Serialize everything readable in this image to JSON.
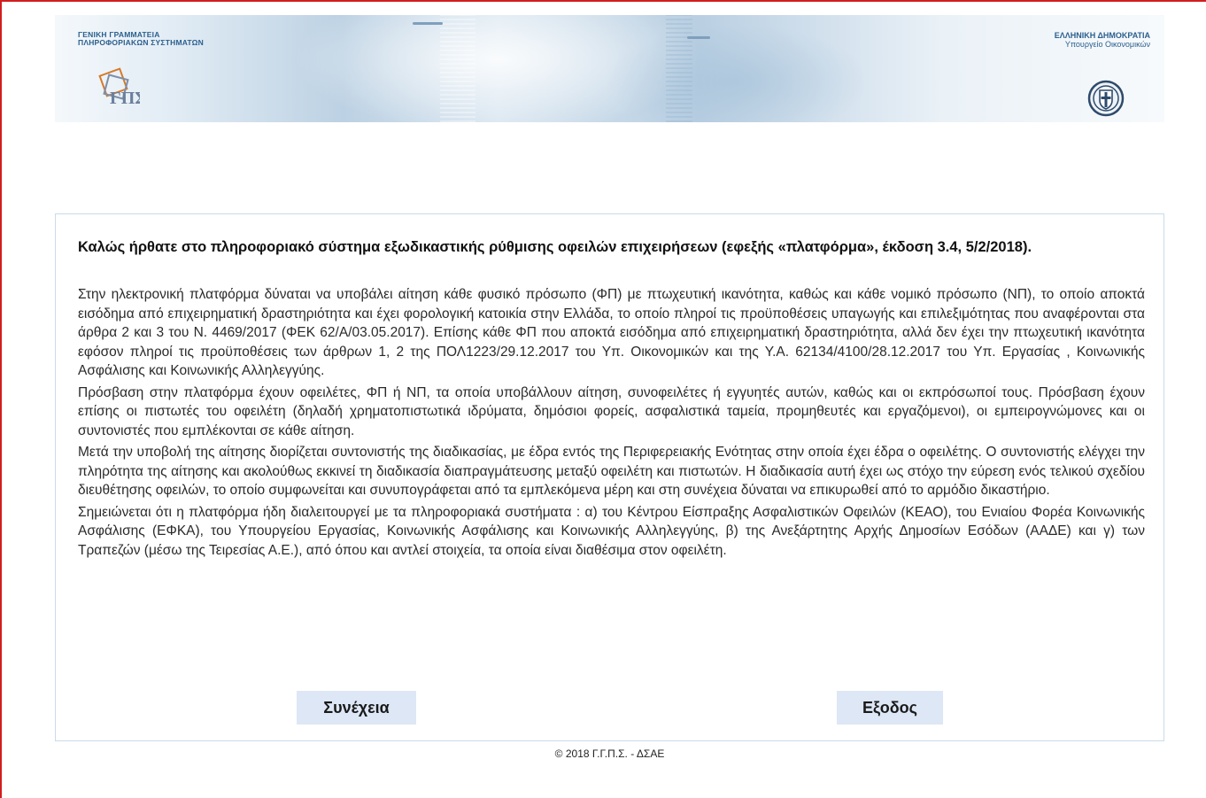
{
  "header": {
    "left_org_line1": "ΓΕΝΙΚΗ ΓΡΑΜΜΑΤΕΙΑ",
    "left_org_line2": "ΠΛΗΡΟΦΟΡΙΑΚΩΝ ΣΥΣΤΗΜΑΤΩΝ",
    "right_org_line1": "ΕΛΛΗΝΙΚΗ ΔΗΜΟΚΡΑΤΙΑ",
    "right_org_line2": "Υπουργείο Οικονομικών",
    "left_logo_icon": "gspis-logo-icon",
    "right_logo_icon": "hellenic-emblem-icon"
  },
  "main": {
    "title": "Καλώς ήρθατε στο πληροφοριακό σύστημα εξωδικαστικής ρύθμισης οφειλών επιχειρήσεων (εφεξής «πλατφόρμα», έκδοση 3.4, 5/2/2018).",
    "paragraphs": [
      "Στην ηλεκτρονική πλατφόρμα δύναται να υποβάλει αίτηση κάθε φυσικό πρόσωπο (ΦΠ) με πτωχευτική ικανότητα, καθώς και κάθε νομικό πρόσωπο (ΝΠ), το οποίο αποκτά εισόδημα από επιχειρηματική δραστηριότητα και έχει φορολογική κατοικία στην Ελλάδα, το οποίο πληροί τις προϋποθέσεις υπαγωγής και επιλεξιμότητας που αναφέρονται στα άρθρα 2 και 3 του Ν. 4469/2017 (ΦΕΚ 62/Α/03.05.2017). Επίσης κάθε ΦΠ που αποκτά εισόδημα από επιχειρηματική δραστηριότητα, αλλά δεν έχει την πτωχευτική ικανότητα εφόσον πληροί τις προϋποθέσεις των άρθρων 1, 2 της ΠΟΛ1223/29.12.2017 του Υπ. Οικονομικών και της Υ.Α. 62134/4100/28.12.2017 του Υπ. Εργασίας , Κοινωνικής Ασφάλισης και Κοινωνικής Αλληλεγγύης.",
      "Πρόσβαση στην πλατφόρμα έχουν οφειλέτες, ΦΠ ή ΝΠ, τα οποία υποβάλλουν αίτηση, συνοφειλέτες ή εγγυητές αυτών, καθώς και οι εκπρόσωποί τους. Πρόσβαση έχουν επίσης οι πιστωτές του οφειλέτη (δηλαδή χρηματοπιστωτικά ιδρύματα, δημόσιοι φορείς, ασφαλιστικά ταμεία, προμηθευτές και εργαζόμενοι), οι εμπειρογνώμονες και οι συντονιστές που εμπλέκονται σε κάθε αίτηση.",
      "Μετά την υποβολή της αίτησης διορίζεται συντονιστής της διαδικασίας, με έδρα εντός της Περιφερειακής Ενότητας στην οποία έχει έδρα ο οφειλέτης. Ο συντονιστής ελέγχει την πληρότητα της αίτησης και ακολούθως εκκινεί τη διαδικασία διαπραγμάτευσης μεταξύ οφειλέτη και πιστωτών. Η διαδικασία αυτή έχει ως στόχο την εύρεση ενός τελικού σχεδίου διευθέτησης οφειλών, το οποίο συμφωνείται και συνυπογράφεται από τα εμπλεκόμενα μέρη και στη συνέχεια δύναται να επικυρωθεί από το αρμόδιο δικαστήριο.",
      "Σημειώνεται ότι η πλατφόρμα ήδη διαλειτουργεί με τα πληροφοριακά συστήματα : α) του Κέντρου Είσπραξης Ασφαλιστικών Οφειλών (ΚΕΑΟ), του Ενιαίου Φορέα Κοινωνικής Ασφάλισης (ΕΦΚΑ), του Υπουργείου Εργασίας, Κοινωνικής Ασφάλισης και Κοινωνικής Αλληλεγγύης, β) της Ανεξάρτητης Αρχής Δημοσίων Εσόδων (ΑΑΔΕ) και γ) των Τραπεζών (μέσω της Τειρεσίας Α.Ε.),  από όπου και αντλεί στοιχεία, τα οποία είναι διαθέσιμα στον οφειλέτη."
    ],
    "continue_label": "Συνέχεια",
    "exit_label": "Εξοδος"
  },
  "footer": {
    "copyright": "© 2018 Γ.Γ.Π.Σ. - ΔΣΑΕ"
  },
  "colors": {
    "frame": "#d21e1e",
    "button_bg": "#dde7f5",
    "header_text": "#2b5f8e",
    "box_border": "#c9dbe9"
  }
}
